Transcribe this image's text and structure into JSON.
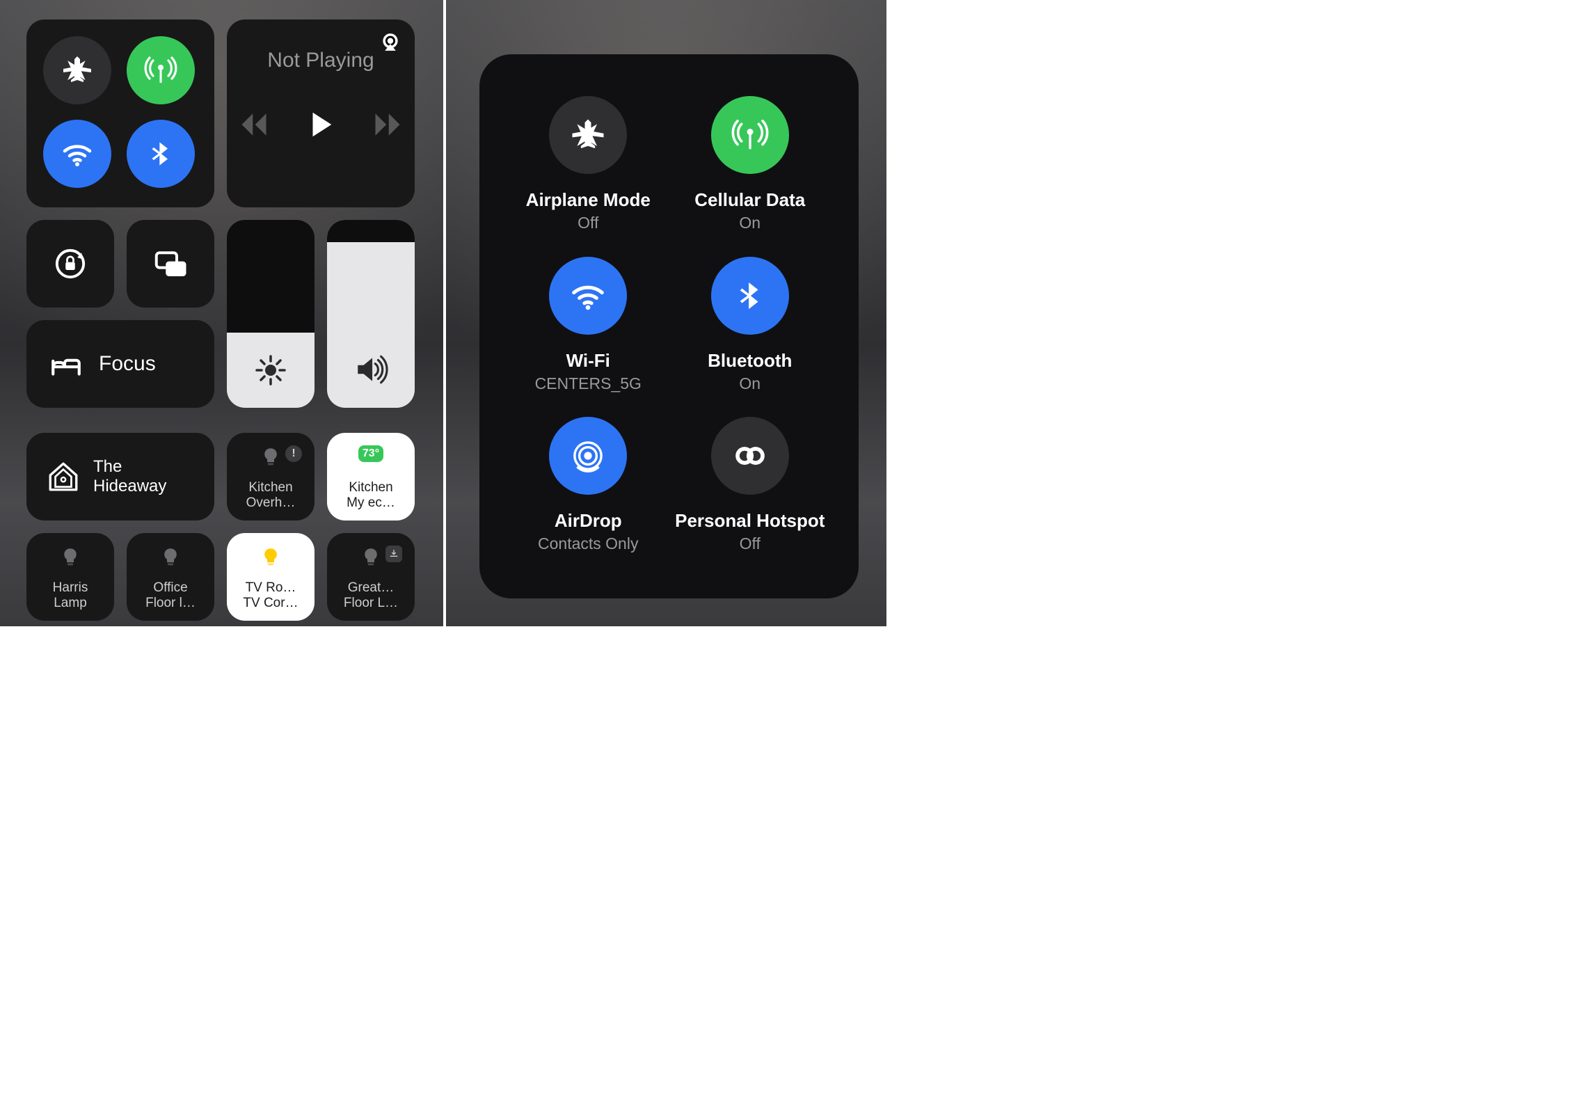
{
  "controlCenter": {
    "connectivity": {
      "airplane": {
        "active": false
      },
      "cellular": {
        "active": true
      },
      "wifi": {
        "active": true
      },
      "bluetooth": {
        "active": true
      }
    },
    "music": {
      "status": "Not Playing"
    },
    "focus": {
      "label": "Focus"
    },
    "sliders": {
      "brightness_pct": 40,
      "volume_pct": 88
    },
    "home": {
      "house_name": "The\nHideaway",
      "tiles": [
        {
          "title": "Kitchen",
          "sub": "Overh…",
          "on": false,
          "icon": "bulb",
          "warn": true
        },
        {
          "title": "Kitchen",
          "sub": "My ec…",
          "on": true,
          "icon": "temp",
          "temp": "73°"
        },
        {
          "title": "Harris",
          "sub": "Lamp",
          "on": false,
          "icon": "bulb"
        },
        {
          "title": "Office",
          "sub": "Floor l…",
          "on": false,
          "icon": "bulb"
        },
        {
          "title": "TV Ro…",
          "sub": "TV Cor…",
          "on": true,
          "icon": "bulb-y"
        },
        {
          "title": "Great…",
          "sub": "Floor L…",
          "on": false,
          "icon": "bulb",
          "download": true
        }
      ]
    }
  },
  "expanded": {
    "items": [
      {
        "name": "Airplane Mode",
        "status": "Off",
        "bubble": "grey",
        "icon": "airplane"
      },
      {
        "name": "Cellular Data",
        "status": "On",
        "bubble": "green",
        "icon": "antenna"
      },
      {
        "name": "Wi-Fi",
        "status": "CENTERS_5G",
        "bubble": "blue",
        "icon": "wifi"
      },
      {
        "name": "Bluetooth",
        "status": "On",
        "bubble": "blue",
        "icon": "bt"
      },
      {
        "name": "AirDrop",
        "status": "Contacts Only",
        "bubble": "blue",
        "icon": "airdrop"
      },
      {
        "name": "Personal Hotspot",
        "status": "Off",
        "bubble": "grey",
        "icon": "hotspot"
      }
    ]
  }
}
